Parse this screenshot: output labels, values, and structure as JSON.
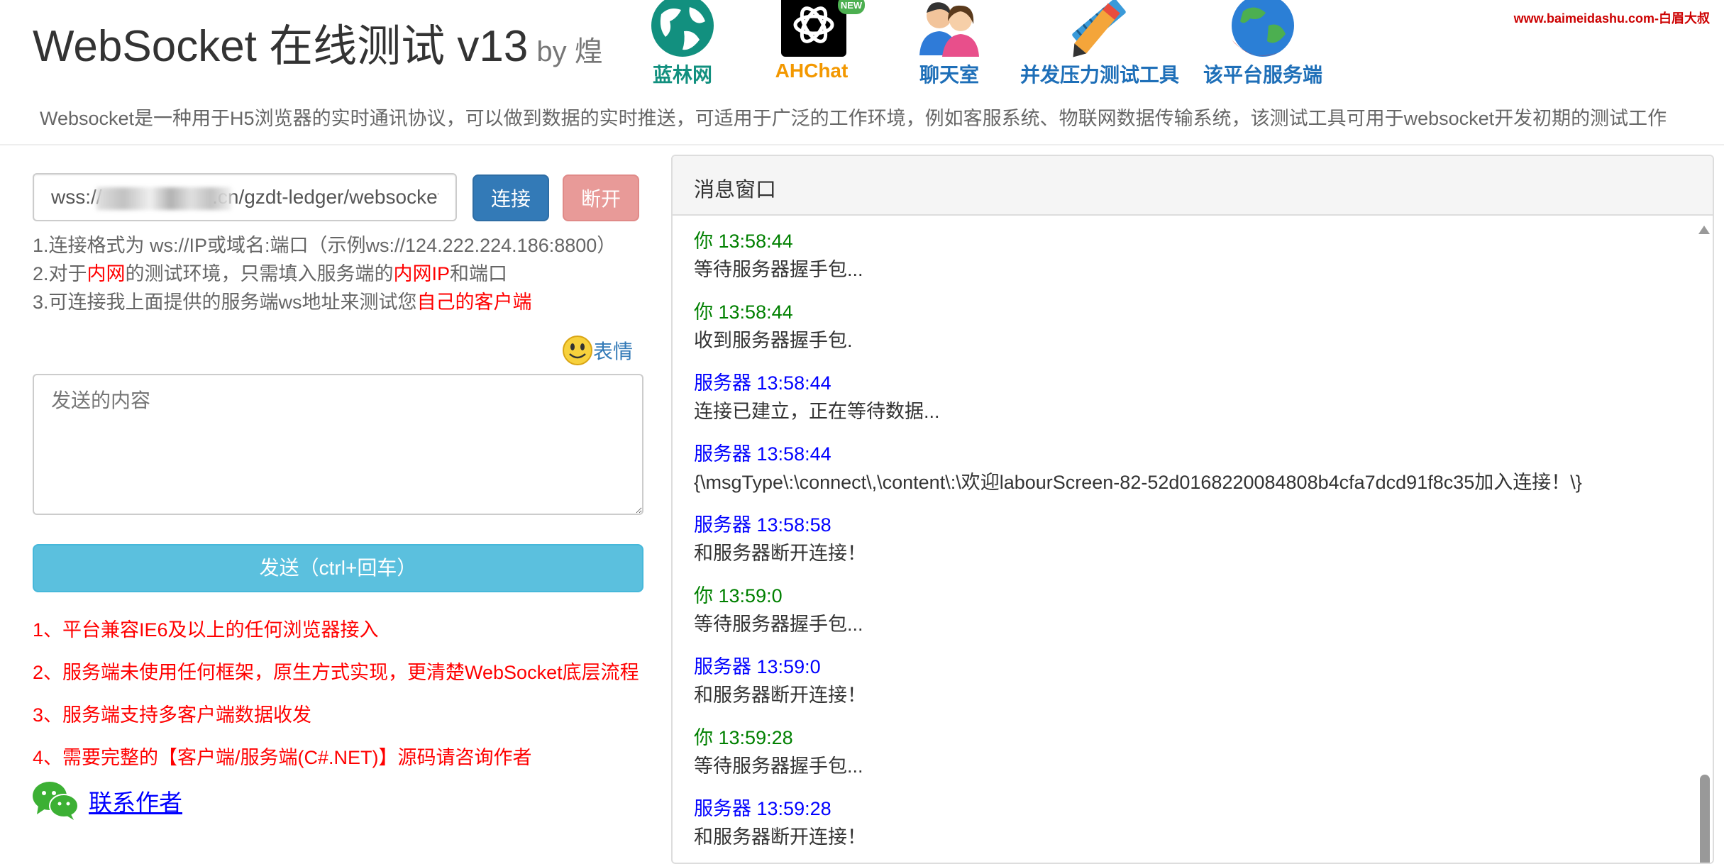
{
  "header": {
    "title": "WebSocket 在线测试 v13",
    "by": "by 煌",
    "watermark": "www.baimeidashu.com-白眉大叔",
    "intro": "Websocket是一种用于H5浏览器的实时通讯协议，可以做到数据的实时推送，可适用于广泛的工作环境，例如客服系统、物联网数据传输系统，该测试工具可用于websocket开发初期的测试工作"
  },
  "nav": [
    {
      "label": "蓝林网",
      "icon": "globe-icon"
    },
    {
      "label": "AHChat",
      "icon": "openai-icon",
      "badge": "NEW"
    },
    {
      "label": "聊天室",
      "icon": "users-icon"
    },
    {
      "label": "并发压力测试工具",
      "icon": "pencil-ruler-icon"
    },
    {
      "label": "该平台服务端",
      "icon": "earth-icon"
    }
  ],
  "connect": {
    "url_value": "wss://                    .cn/gzdt-ledger/websocket",
    "connect_label": "连接",
    "disconnect_label": "断开"
  },
  "tips": {
    "tip1": "1.连接格式为 ws://IP或域名:端口（示例ws://124.222.224.186:8800）",
    "tip2_a": "2.对于",
    "tip2_b": "内网",
    "tip2_c": "的测试环境，只需填入服务端的",
    "tip2_d": "内网IP",
    "tip2_e": "和端口",
    "tip3_a": "3.可连接我上面提供的服务端ws地址来测试您",
    "tip3_b": "自己的客户端"
  },
  "emoji": {
    "label": "表情",
    "icon": "smiley-icon"
  },
  "compose": {
    "placeholder": "发送的内容",
    "send_label": "发送（ctrl+回车）"
  },
  "notes": [
    "1、平台兼容IE6及以上的任何浏览器接入",
    "2、服务端未使用任何框架，原生方式实现，更清楚WebSocket底层流程",
    "3、服务端支持多客户端数据收发",
    "4、需要完整的【客户端/服务端(C#.NET)】源码请咨询作者"
  ],
  "contact": {
    "label": "联系作者",
    "icon": "wechat-icon"
  },
  "panel": {
    "title": "消息窗口",
    "messages": [
      {
        "sender": "你",
        "time": "13:58:44",
        "text": "等待服务器握手包..."
      },
      {
        "sender": "你",
        "time": "13:58:44",
        "text": "收到服务器握手包."
      },
      {
        "sender": "服务器",
        "time": "13:58:44",
        "text": "连接已建立，正在等待数据..."
      },
      {
        "sender": "服务器",
        "time": "13:58:44",
        "text": "{\\msgType\\:\\connect\\,\\content\\:\\欢迎labourScreen-82-52d0168220084808b4cfa7dcd91f8c35加入连接！\\}"
      },
      {
        "sender": "服务器",
        "time": "13:58:58",
        "text": "和服务器断开连接！"
      },
      {
        "sender": "你",
        "time": "13:59:0",
        "text": "等待服务器握手包..."
      },
      {
        "sender": "服务器",
        "time": "13:59:0",
        "text": "和服务器断开连接！"
      },
      {
        "sender": "你",
        "time": "13:59:28",
        "text": "等待服务器握手包..."
      },
      {
        "sender": "服务器",
        "time": "13:59:28",
        "text": "和服务器断开连接！"
      }
    ]
  },
  "colors": {
    "you": "#008000",
    "server": "#0000ff",
    "primary": "#337ab7",
    "danger_light": "#e89a98",
    "info": "#5bc0de",
    "note_red": "#ff0000"
  }
}
